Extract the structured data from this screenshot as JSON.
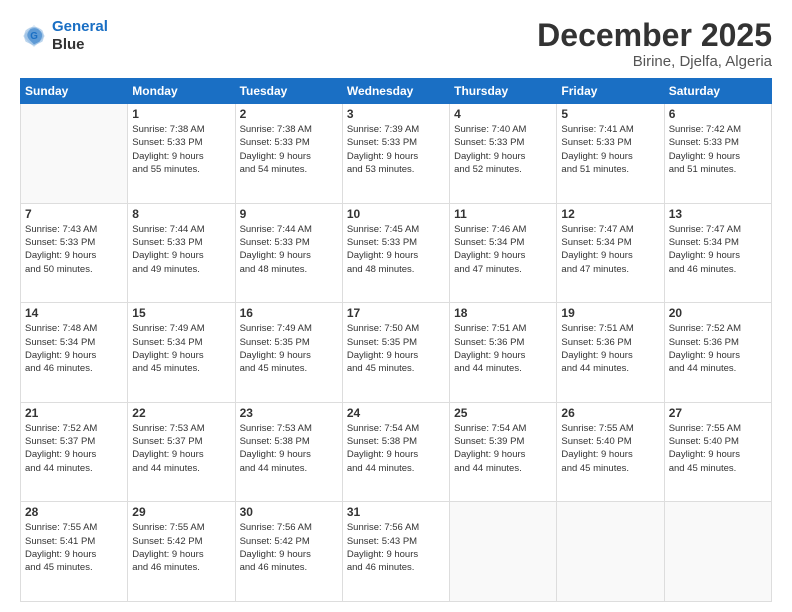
{
  "logo": {
    "line1": "General",
    "line2": "Blue"
  },
  "title": "December 2025",
  "subtitle": "Birine, Djelfa, Algeria",
  "days_of_week": [
    "Sunday",
    "Monday",
    "Tuesday",
    "Wednesday",
    "Thursday",
    "Friday",
    "Saturday"
  ],
  "weeks": [
    [
      {
        "day": "",
        "info": ""
      },
      {
        "day": "1",
        "info": "Sunrise: 7:38 AM\nSunset: 5:33 PM\nDaylight: 9 hours\nand 55 minutes."
      },
      {
        "day": "2",
        "info": "Sunrise: 7:38 AM\nSunset: 5:33 PM\nDaylight: 9 hours\nand 54 minutes."
      },
      {
        "day": "3",
        "info": "Sunrise: 7:39 AM\nSunset: 5:33 PM\nDaylight: 9 hours\nand 53 minutes."
      },
      {
        "day": "4",
        "info": "Sunrise: 7:40 AM\nSunset: 5:33 PM\nDaylight: 9 hours\nand 52 minutes."
      },
      {
        "day": "5",
        "info": "Sunrise: 7:41 AM\nSunset: 5:33 PM\nDaylight: 9 hours\nand 51 minutes."
      },
      {
        "day": "6",
        "info": "Sunrise: 7:42 AM\nSunset: 5:33 PM\nDaylight: 9 hours\nand 51 minutes."
      }
    ],
    [
      {
        "day": "7",
        "info": "Sunrise: 7:43 AM\nSunset: 5:33 PM\nDaylight: 9 hours\nand 50 minutes."
      },
      {
        "day": "8",
        "info": "Sunrise: 7:44 AM\nSunset: 5:33 PM\nDaylight: 9 hours\nand 49 minutes."
      },
      {
        "day": "9",
        "info": "Sunrise: 7:44 AM\nSunset: 5:33 PM\nDaylight: 9 hours\nand 48 minutes."
      },
      {
        "day": "10",
        "info": "Sunrise: 7:45 AM\nSunset: 5:33 PM\nDaylight: 9 hours\nand 48 minutes."
      },
      {
        "day": "11",
        "info": "Sunrise: 7:46 AM\nSunset: 5:34 PM\nDaylight: 9 hours\nand 47 minutes."
      },
      {
        "day": "12",
        "info": "Sunrise: 7:47 AM\nSunset: 5:34 PM\nDaylight: 9 hours\nand 47 minutes."
      },
      {
        "day": "13",
        "info": "Sunrise: 7:47 AM\nSunset: 5:34 PM\nDaylight: 9 hours\nand 46 minutes."
      }
    ],
    [
      {
        "day": "14",
        "info": "Sunrise: 7:48 AM\nSunset: 5:34 PM\nDaylight: 9 hours\nand 46 minutes."
      },
      {
        "day": "15",
        "info": "Sunrise: 7:49 AM\nSunset: 5:34 PM\nDaylight: 9 hours\nand 45 minutes."
      },
      {
        "day": "16",
        "info": "Sunrise: 7:49 AM\nSunset: 5:35 PM\nDaylight: 9 hours\nand 45 minutes."
      },
      {
        "day": "17",
        "info": "Sunrise: 7:50 AM\nSunset: 5:35 PM\nDaylight: 9 hours\nand 45 minutes."
      },
      {
        "day": "18",
        "info": "Sunrise: 7:51 AM\nSunset: 5:36 PM\nDaylight: 9 hours\nand 44 minutes."
      },
      {
        "day": "19",
        "info": "Sunrise: 7:51 AM\nSunset: 5:36 PM\nDaylight: 9 hours\nand 44 minutes."
      },
      {
        "day": "20",
        "info": "Sunrise: 7:52 AM\nSunset: 5:36 PM\nDaylight: 9 hours\nand 44 minutes."
      }
    ],
    [
      {
        "day": "21",
        "info": "Sunrise: 7:52 AM\nSunset: 5:37 PM\nDaylight: 9 hours\nand 44 minutes."
      },
      {
        "day": "22",
        "info": "Sunrise: 7:53 AM\nSunset: 5:37 PM\nDaylight: 9 hours\nand 44 minutes."
      },
      {
        "day": "23",
        "info": "Sunrise: 7:53 AM\nSunset: 5:38 PM\nDaylight: 9 hours\nand 44 minutes."
      },
      {
        "day": "24",
        "info": "Sunrise: 7:54 AM\nSunset: 5:38 PM\nDaylight: 9 hours\nand 44 minutes."
      },
      {
        "day": "25",
        "info": "Sunrise: 7:54 AM\nSunset: 5:39 PM\nDaylight: 9 hours\nand 44 minutes."
      },
      {
        "day": "26",
        "info": "Sunrise: 7:55 AM\nSunset: 5:40 PM\nDaylight: 9 hours\nand 45 minutes."
      },
      {
        "day": "27",
        "info": "Sunrise: 7:55 AM\nSunset: 5:40 PM\nDaylight: 9 hours\nand 45 minutes."
      }
    ],
    [
      {
        "day": "28",
        "info": "Sunrise: 7:55 AM\nSunset: 5:41 PM\nDaylight: 9 hours\nand 45 minutes."
      },
      {
        "day": "29",
        "info": "Sunrise: 7:55 AM\nSunset: 5:42 PM\nDaylight: 9 hours\nand 46 minutes."
      },
      {
        "day": "30",
        "info": "Sunrise: 7:56 AM\nSunset: 5:42 PM\nDaylight: 9 hours\nand 46 minutes."
      },
      {
        "day": "31",
        "info": "Sunrise: 7:56 AM\nSunset: 5:43 PM\nDaylight: 9 hours\nand 46 minutes."
      },
      {
        "day": "",
        "info": ""
      },
      {
        "day": "",
        "info": ""
      },
      {
        "day": "",
        "info": ""
      }
    ]
  ]
}
